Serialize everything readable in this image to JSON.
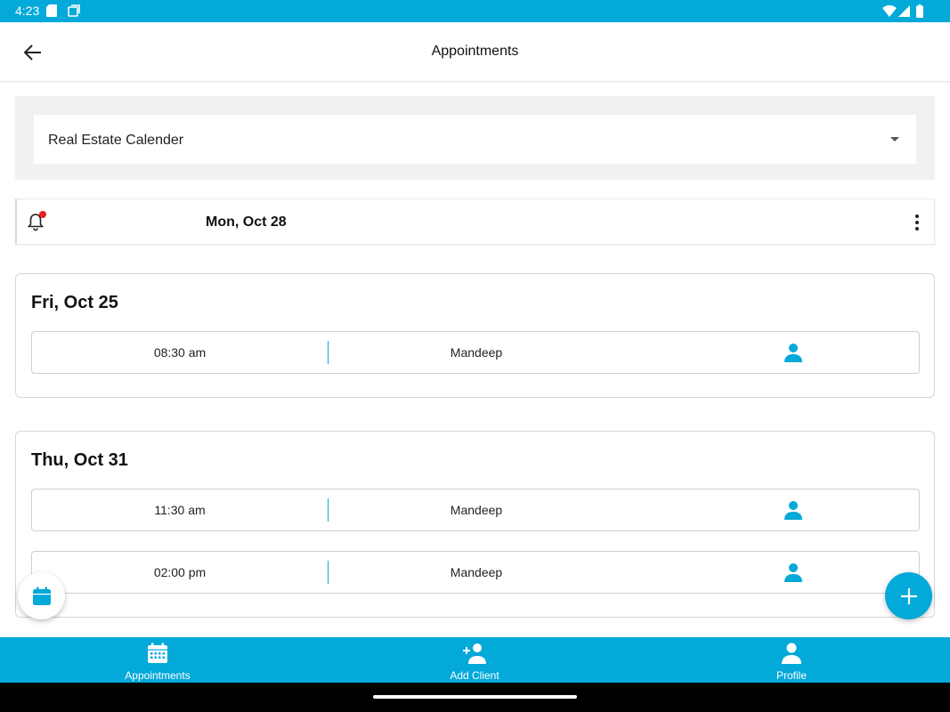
{
  "status_bar": {
    "time": "4:23",
    "left_icons": [
      "sd-card-icon",
      "screenshot-icon"
    ],
    "right_icons": [
      "wifi-icon",
      "signal-icon",
      "battery-icon"
    ]
  },
  "app_bar": {
    "title": "Appointments",
    "back_icon": "arrow-back-icon"
  },
  "calendar_select": {
    "value": "Real Estate Calender"
  },
  "date_bar": {
    "date": "Mon, Oct 28",
    "notification_badge_color": "#e82020"
  },
  "days": [
    {
      "title": "Fri, Oct 25",
      "appointments": [
        {
          "time": "08:30 am",
          "name": "Mandeep"
        }
      ]
    },
    {
      "title": "Thu, Oct 31",
      "appointments": [
        {
          "time": "11:30 am",
          "name": "Mandeep"
        },
        {
          "time": "02:00 pm",
          "name": "Mandeep"
        }
      ]
    }
  ],
  "bottom_nav": {
    "items": [
      {
        "label": "Appointments",
        "icon": "calendar-icon"
      },
      {
        "label": "Add Client",
        "icon": "add-person-icon"
      },
      {
        "label": "Profile",
        "icon": "person-icon"
      }
    ]
  },
  "colors": {
    "accent": "#03a9d8",
    "badge": "#e82020"
  }
}
